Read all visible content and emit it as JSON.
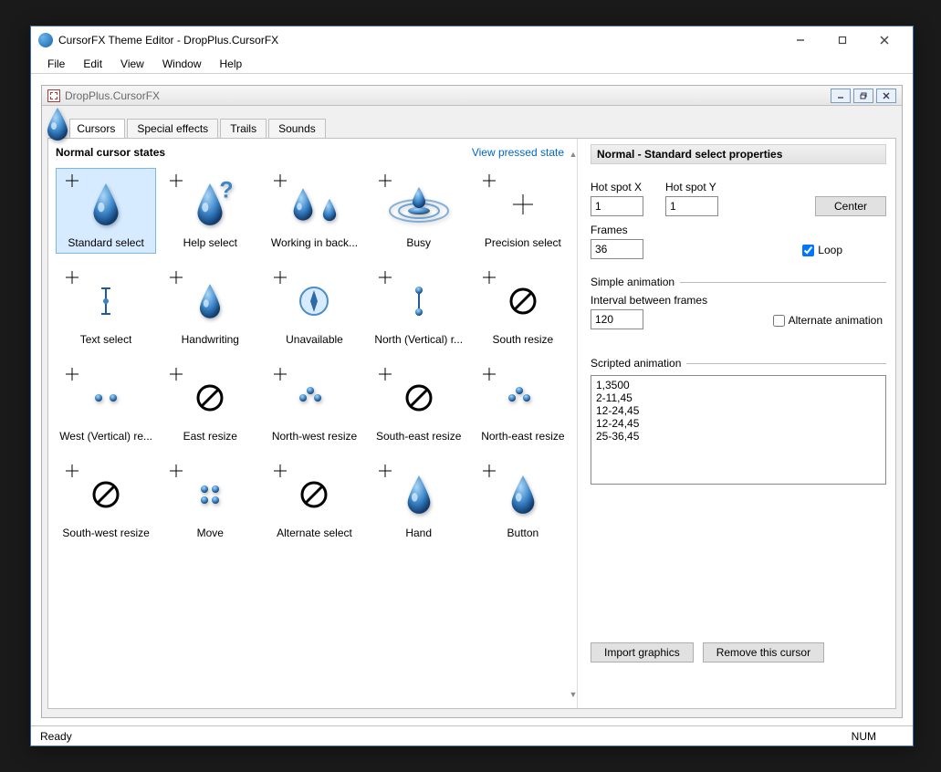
{
  "window": {
    "title": "CursorFX Theme Editor - DropPlus.CursorFX"
  },
  "menu": {
    "file": "File",
    "edit": "Edit",
    "view": "View",
    "window": "Window",
    "help": "Help"
  },
  "document": {
    "title": "DropPlus.CursorFX"
  },
  "tabs": {
    "cursors": "Cursors",
    "special": "Special effects",
    "trails": "Trails",
    "sounds": "Sounds"
  },
  "leftPane": {
    "title": "Normal cursor states",
    "link": "View pressed state",
    "items": [
      "Standard select",
      "Help select",
      "Working in back...",
      "Busy",
      "Precision select",
      "Text select",
      "Handwriting",
      "Unavailable",
      "North (Vertical) r...",
      "South resize",
      "West (Vertical) re...",
      "East resize",
      "North-west resize",
      "South-east resize",
      "North-east resize",
      "South-west resize",
      "Move",
      "Alternate select",
      "Hand",
      "Button"
    ]
  },
  "props": {
    "title": "Normal - Standard select properties",
    "hotspotX": {
      "label": "Hot spot X",
      "value": "1"
    },
    "hotspotY": {
      "label": "Hot spot Y",
      "value": "1"
    },
    "center": "Center",
    "frames": {
      "label": "Frames",
      "value": "36"
    },
    "loop": "Loop",
    "simpleAnim": "Simple animation",
    "interval": {
      "label": "Interval between frames",
      "value": "120"
    },
    "altAnim": "Alternate animation",
    "scripted": "Scripted animation",
    "script": "1,3500\n2-11,45\n12-24,45\n12-24,45\n25-36,45",
    "import": "Import graphics",
    "remove": "Remove this cursor"
  },
  "status": {
    "ready": "Ready",
    "num": "NUM"
  }
}
